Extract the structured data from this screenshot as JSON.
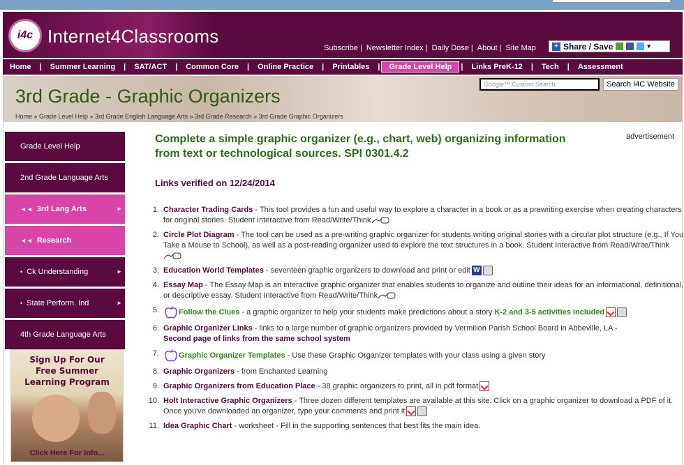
{
  "site": {
    "name": "Internet4Classrooms",
    "logo_text": "i4c"
  },
  "toplinks": [
    "Subscribe",
    "Newsletter Index",
    "Daily Dose",
    "About",
    "Site Map"
  ],
  "share_label": "Share / Save",
  "nav": [
    "Home",
    "Summer Learning",
    "SAT/ACT",
    "Common Core",
    "Online Practice",
    "Printables",
    "Grade Level Help",
    "Links PreK-12",
    "Tech",
    "Assessment"
  ],
  "nav_active": "Grade Level Help",
  "banner": {
    "title_grade": "3rd Grade",
    "title_rest": " - Graphic Organizers",
    "breadcrumb": "Home » Grade Level Help » 3rd Grade English Language Arts » 3rd Grade Research » 3rd Grade Graphic Organizers",
    "search_placeholder": "Google™ Custom Search",
    "search_button": "Search I4C Website"
  },
  "sidebar": [
    {
      "label": "Grade Level Help",
      "style": "dark",
      "prefix": "",
      "arrow": false
    },
    {
      "label": "2nd Grade Language Arts",
      "style": "dark",
      "prefix": "",
      "arrow": false
    },
    {
      "label": "3rd Lang Arts",
      "style": "pink",
      "prefix": "◄◄",
      "arrow": true
    },
    {
      "label": "Research",
      "style": "pink",
      "prefix": "◄◄",
      "arrow": false
    },
    {
      "label": "Ck Understanding",
      "style": "dark",
      "prefix": "•",
      "arrow": true
    },
    {
      "label": "State Perform. Ind",
      "style": "dark",
      "prefix": "•",
      "arrow": true
    },
    {
      "label": "4th Grade Language Arts",
      "style": "dark",
      "prefix": "",
      "arrow": false
    }
  ],
  "promo": {
    "line1": "Sign Up For Our",
    "line2": "Free Summer",
    "line3": "Learning Program",
    "footer": "Click Here For Info..."
  },
  "main": {
    "heading": "Complete a simple graphic organizer (e.g., chart, web) organizing information from text or technological sources. SPI 0301.4.2",
    "advertisement": "advertisement",
    "verified": "Links verified on 12/24/2014"
  },
  "colors": {
    "brand": "#5a0a3e",
    "accent": "#d944a8",
    "heading_green": "#2e6b1a"
  },
  "links": [
    {
      "num": "1.",
      "title": "Character Trading Cards",
      "desc": " - This tool provides a fun and useful way to explore a character in a book or as a prewriting exercise when creating characters for original stories. Student Interactive from Read/Write/Think",
      "icons": [
        "external"
      ]
    },
    {
      "num": "2.",
      "title": "Circle Plot Diagram",
      "desc": " - The tool can be used as a pre-writing graphic organizer for students writing original stories with a circular plot structure (e.g., If You Take a Mouse to School), as well as a post-reading organizer used to explore the text structures in a book. Student Interactive from Read/Write/Think",
      "icons": [
        "external"
      ]
    },
    {
      "num": "3.",
      "title": "Education World Templates",
      "desc": " - seventeen graphic organizers to download and print or edit",
      "icons": [
        "word",
        "print"
      ]
    },
    {
      "num": "4.",
      "title": "Essay Map",
      "desc": " - The Essay Map is an interactive graphic organizer that enables students to organize and outline their ideas for an informational, definitional, or descriptive essay. Student Interactive from Read/Write/Think",
      "icons": [
        "external"
      ]
    },
    {
      "num": "5.",
      "title": "Follow the Clues",
      "desc": " - a graphic organizer to help your students make predictions about a story ",
      "extra": "K-2 and 3-5 activities included",
      "icons": [
        "pdf",
        "print"
      ],
      "apple": true
    },
    {
      "num": "6.",
      "title": "Graphic Organizer Links",
      "desc": " - links to a large number of graphic organizers provided by Vermilion Parish School Board in Abbeville, LA - ",
      "extra": "Second page of links from the same school system",
      "icons": []
    },
    {
      "num": "7.",
      "title": "Graphic Organizer Templates",
      "desc": " - Use these Graphic Organizer templates with your class using a given story",
      "icons": [],
      "apple": true
    },
    {
      "num": "8.",
      "title": "Graphic Organizers",
      "desc": " - from Enchanted Learning",
      "icons": []
    },
    {
      "num": "9.",
      "title": "Graphic Organizers from Education Place",
      "desc": " - 38 graphic organizers to print, all in pdf format",
      "icons": [
        "pdf"
      ]
    },
    {
      "num": "10.",
      "title": "Holt Interactive Graphic Organizers",
      "desc": " - Three dozen different templates are available at this site. Click on a graphic organizer to download a PDF of it. Once you've downloaded an organizer, type your comments and print it",
      "icons": [
        "pdf",
        "print"
      ]
    },
    {
      "num": "11.",
      "title": "Idea Graphic Chart",
      "desc": " - worksheet - Fill in the supporting sentences that best fits the main idea.",
      "icons": []
    }
  ]
}
